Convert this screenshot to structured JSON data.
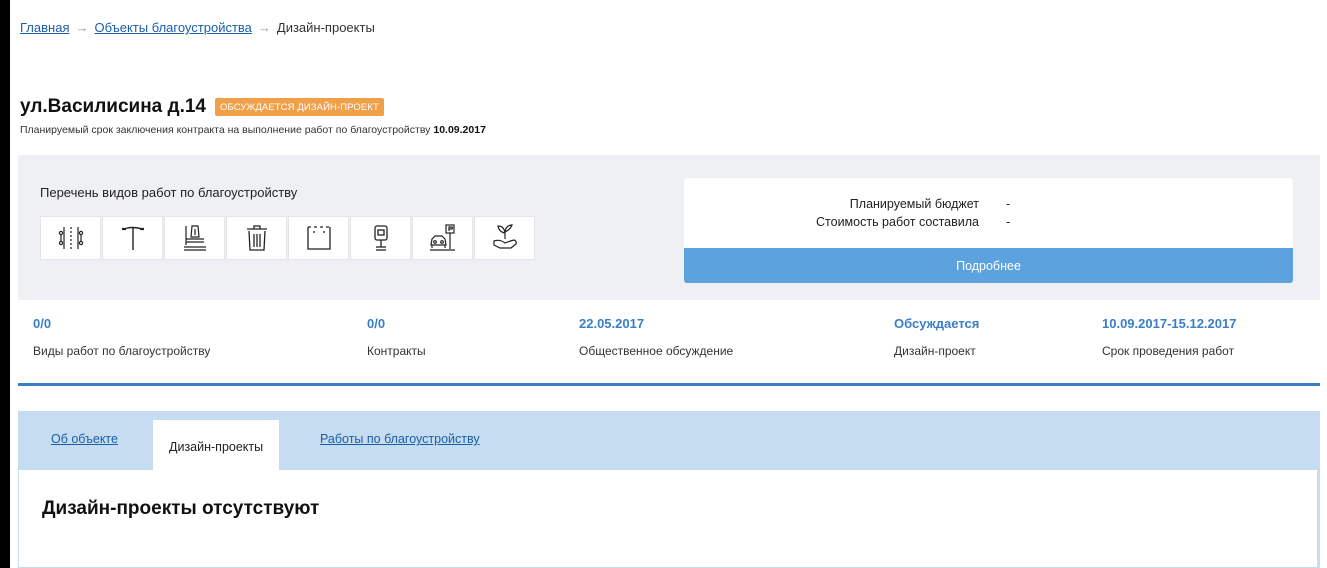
{
  "breadcrumb": {
    "items": [
      "Главная",
      "Объекты благоустройства",
      "Дизайн-проекты"
    ],
    "separator": "→"
  },
  "object": {
    "title": "ул.Василисина д.14",
    "badge": "ОБСУЖДАЕТСЯ ДИЗАЙН-ПРОЕКТ",
    "badge_color": "#f0a04b",
    "contract_text": "Планируемый срок заключения контракта на выполнение работ по благоустройству",
    "contract_date": "10.09.2017"
  },
  "works": {
    "title": "Перечень видов работ по благоустройству",
    "icons": [
      "fountain-icon",
      "street-lamp-icon",
      "bench-playground-icon",
      "trash-bin-icon",
      "fence-icon",
      "bollard-light-icon",
      "parking-icon",
      "landscaping-icon"
    ]
  },
  "budget": {
    "planned_label": "Планируемый бюджет",
    "planned_value": "-",
    "cost_label": "Стоимость работ составила",
    "cost_value": "-",
    "more_button": "Подробнее"
  },
  "stats": [
    {
      "value": "0/0",
      "label": "Виды работ по благоустройству"
    },
    {
      "value": "0/0",
      "label": "Контракты"
    },
    {
      "value": "22.05.2017",
      "label": "Общественное обсуждение"
    },
    {
      "value": "Обсуждается",
      "label": "Дизайн-проект"
    },
    {
      "value": "10.09.2017-15.12.2017",
      "label": "Срок проведения работ"
    }
  ],
  "tabs": [
    {
      "label": "Об объекте",
      "active": false
    },
    {
      "label": "Дизайн-проекты",
      "active": true
    },
    {
      "label": "Работы по благоустройству",
      "active": false
    }
  ],
  "content": {
    "heading": "Дизайн-проекты отсутствуют"
  },
  "colors": {
    "accent": "#3a7fc6",
    "button": "#5ba2df",
    "tabs_bg": "#c6dcf0"
  }
}
